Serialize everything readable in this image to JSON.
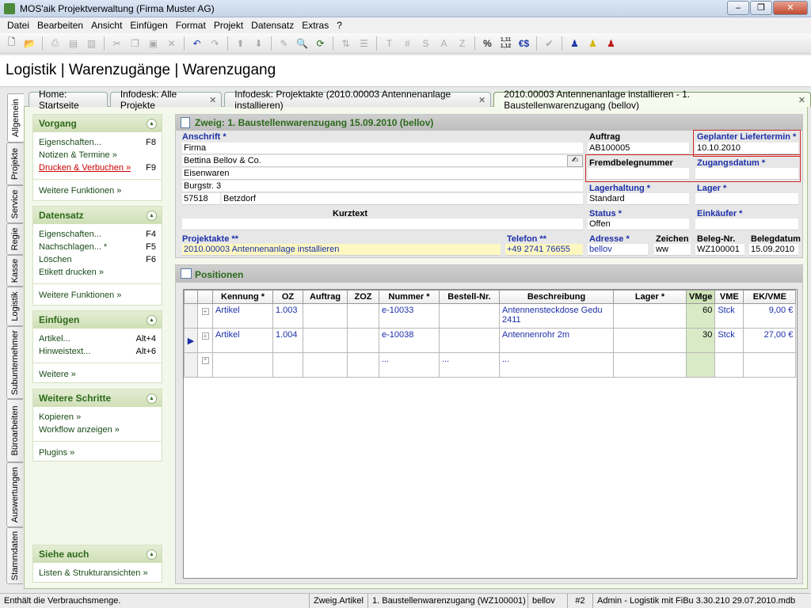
{
  "window": {
    "title": "MOS'aik Projektverwaltung (Firma Muster AG)",
    "minimize": "–",
    "maximize": "❐",
    "close": "✕"
  },
  "menu": [
    "Datei",
    "Bearbeiten",
    "Ansicht",
    "Einfügen",
    "Format",
    "Projekt",
    "Datensatz",
    "Extras",
    "?"
  ],
  "toolbar": {
    "icons": [
      "new-icon",
      "open-icon",
      "save-icon",
      "print-icon",
      "print-preview-icon",
      "delete-icon",
      "cut-icon",
      "copy-icon",
      "paste-icon",
      "cancel-icon",
      "undo-icon",
      "redo-icon",
      "move-up-icon",
      "move-down-icon",
      "edit-icon",
      "find-icon",
      "refresh-icon",
      "sort-icon",
      "hash-icon",
      "sum-icon",
      "text-s-icon",
      "text-a-icon",
      "text-z-icon",
      "percent-icon",
      "decimal-icon",
      "currency-icon",
      "mark-icon",
      "user-blue-icon",
      "user-yellow-icon",
      "user-red-icon"
    ],
    "glyphs": {
      "percent": "%",
      "decimal": "1,11 1,12",
      "currency": "€$",
      "text_t": "T",
      "hash": "#",
      "s": "S",
      "a": "A",
      "z": "Z"
    }
  },
  "breadcrumb": "Logistik | Warenzugänge | Warenzugang",
  "tabs": [
    {
      "label": "Home: Startseite"
    },
    {
      "label": "Infodesk: Alle Projekte"
    },
    {
      "label": "Infodesk: Projektakte (2010.00003 Antennenanlage installieren)"
    },
    {
      "label": "2010.00003 Antennenanlage installieren - 1. Baustellenwarenzugang (bellov)"
    }
  ],
  "tab_close": "✕",
  "vtabs": [
    "Allgemein",
    "Projekte",
    "Service",
    "Regie",
    "Kasse",
    "Logistik",
    "Subunternehmer",
    "Büroarbeiten",
    "Auswertungen",
    "Stammdaten"
  ],
  "left": {
    "vorgang": {
      "title": "Vorgang",
      "items": [
        {
          "label": "Eigenschaften...",
          "key": "F8"
        },
        {
          "label": "Notizen & Termine »",
          "key": ""
        },
        {
          "label": "Drucken & Verbuchen »",
          "key": "F9"
        }
      ],
      "more": "Weitere Funktionen »"
    },
    "datensatz": {
      "title": "Datensatz",
      "items": [
        {
          "label": "Eigenschaften...",
          "key": "F4"
        },
        {
          "label": "Nachschlagen... *",
          "key": "F5"
        },
        {
          "label": "Löschen",
          "key": "F6"
        },
        {
          "label": "Etikett drucken »",
          "key": ""
        }
      ],
      "more": "Weitere Funktionen »"
    },
    "einfuegen": {
      "title": "Einfügen",
      "items": [
        {
          "label": "Artikel...",
          "key": "Alt+4"
        },
        {
          "label": "Hinweistext...",
          "key": "Alt+6"
        }
      ],
      "more": "Weitere »"
    },
    "schritte": {
      "title": "Weitere Schritte",
      "items": [
        {
          "label": "Kopieren »"
        },
        {
          "label": "Workflow anzeigen »"
        }
      ],
      "more": "Plugins »"
    },
    "siehe": {
      "title": "Siehe auch",
      "items": [
        {
          "label": "Listen & Strukturansichten »"
        }
      ]
    }
  },
  "form": {
    "title": "Zweig: 1. Baustellenwarenzugang 15.09.2010 (bellov)",
    "anschrift_label": "Anschrift *",
    "anschrift": [
      "Firma",
      "Bettina Bellov & Co.",
      "Eisenwaren",
      "Burgstr. 3"
    ],
    "plz": "57518",
    "ort": "Betzdorf",
    "kurztext_label": "Kurztext",
    "kurztext": "",
    "auftrag_label": "Auftrag",
    "auftrag": "AB100005",
    "liefertermin_label": "Geplanter Liefertermin *",
    "liefertermin": "10.10.2010",
    "fremdbeleg_label": "Fremdbelegnummer",
    "fremdbeleg": "",
    "zugangsdatum_label": "Zugangsdatum *",
    "zugangsdatum": "",
    "lagerhaltung_label": "Lagerhaltung *",
    "lagerhaltung": "Standard",
    "lager_label": "Lager *",
    "lager": "",
    "status_label": "Status *",
    "status": "Offen",
    "einkaeufer_label": "Einkäufer *",
    "einkaeufer": "",
    "projektakte_label": "Projektakte **",
    "projektakte": "2010.00003 Antennenanlage installieren",
    "telefon_label": "Telefon **",
    "telefon": "+49 2741 76655",
    "adresse_label": "Adresse *",
    "adresse": "bellov",
    "zeichen_label": "Zeichen",
    "zeichen": "ww",
    "belegnr_label": "Beleg-Nr.",
    "belegnr": "WZ100001",
    "belegdatum_label": "Belegdatum",
    "belegdatum": "15.09.2010"
  },
  "positionen": {
    "title": "Positionen",
    "columns": [
      "Kennung *",
      "OZ",
      "Auftrag",
      "ZOZ",
      "Nummer *",
      "Bestell-Nr.",
      "Beschreibung",
      "Lager *",
      "VMge",
      "VME",
      "EK/VME"
    ],
    "rows": [
      {
        "indicator": "",
        "expand": "+",
        "kennung": "Artikel",
        "oz": "1.003",
        "auftrag": "",
        "zoz": "",
        "nummer": "e-10033",
        "bestellnr": "",
        "beschreibung": "Antennensteckdose Gedu 2411",
        "lager": "",
        "vmge": "60",
        "vme": "Stck",
        "ek": "9,00 €"
      },
      {
        "indicator": "▶",
        "expand": "+",
        "kennung": "Artikel",
        "oz": "1.004",
        "auftrag": "",
        "zoz": "",
        "nummer": "e-10038",
        "bestellnr": "",
        "beschreibung": "Antennenrohr 2m",
        "lager": "",
        "vmge": "30",
        "vme": "Stck",
        "ek": "27,00 €"
      }
    ],
    "new_row": {
      "expand": "*",
      "dots": "..."
    }
  },
  "status": [
    "Enthält die Verbrauchsmenge.",
    "Zweig.Artikel",
    "1. Baustellenwarenzugang (WZ100001)",
    "bellov",
    "#2",
    "Admin - Logistik mit FiBu 3.30.210 29.07.2010.mdb"
  ]
}
